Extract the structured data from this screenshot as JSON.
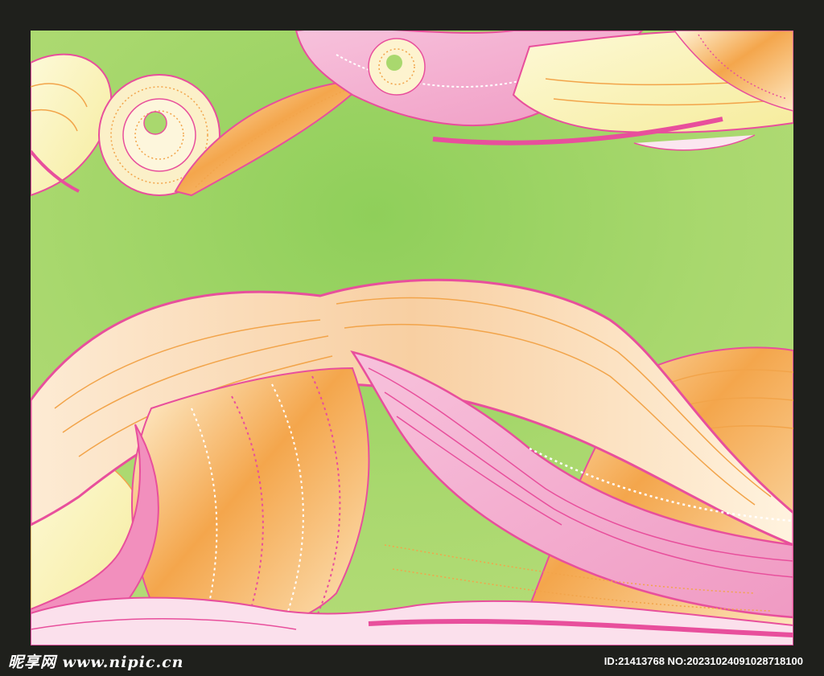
{
  "artwork": {
    "description_colors": {
      "background": "#a7d66a",
      "pink": "#e84f9c",
      "light_pink": "#f3b3d0",
      "orange": "#f2a44a",
      "cream": "#fbf0c8",
      "frame": "#1f201c"
    }
  },
  "footer": {
    "brand": "昵享网 www.nipic.cn",
    "meta": "ID:21413768 NO:20231024091028718100"
  }
}
